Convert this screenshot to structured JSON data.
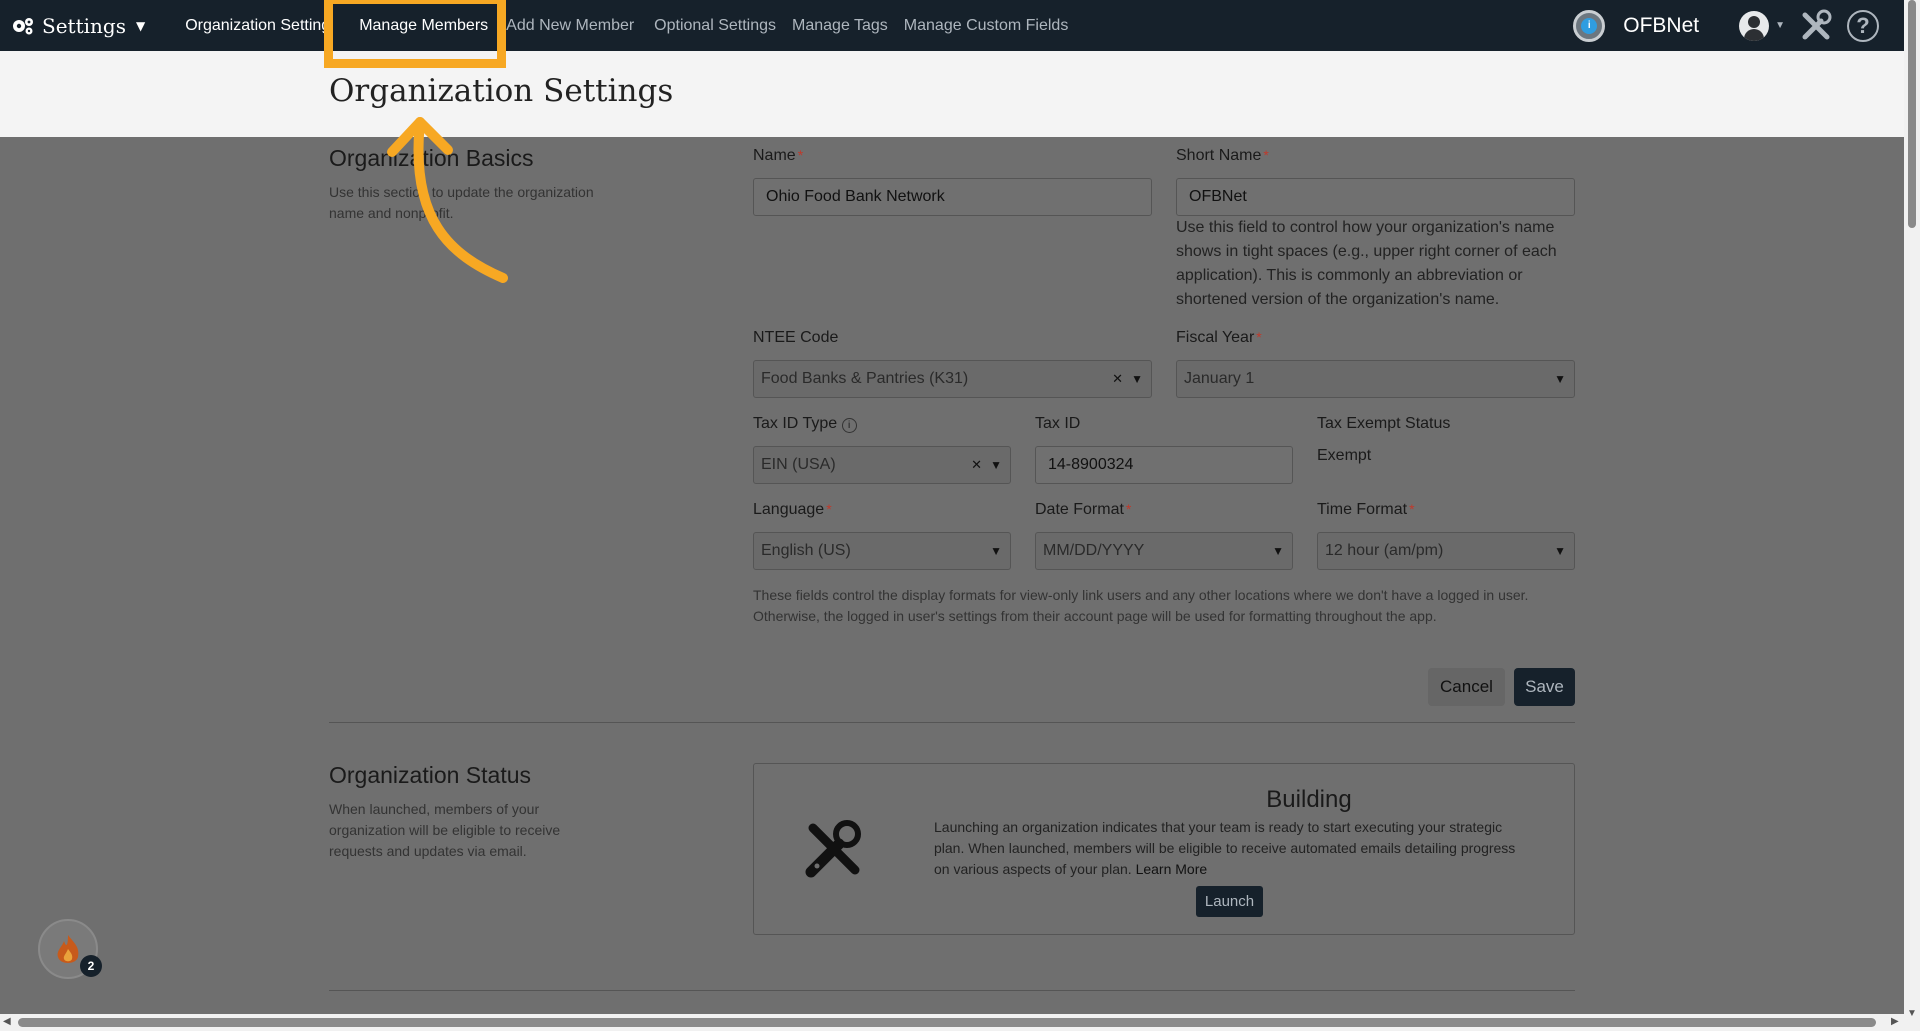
{
  "nav": {
    "brand_label": "Settings",
    "links": {
      "org_settings": "Organization Settings",
      "manage_members": "Manage Members",
      "add_new_member": "Add New Member",
      "optional_settings": "Optional Settings",
      "manage_tags": "Manage Tags",
      "manage_custom_fields": "Manage Custom Fields"
    },
    "org_name": "OFBNet",
    "org_icon_letter": "i"
  },
  "page": {
    "title": "Organization Settings"
  },
  "basics": {
    "title": "Organization Basics",
    "description": "Use this section to update the organization name and nonprofit.",
    "name_label": "Name",
    "name_value": "Ohio Food Bank Network",
    "short_name_label": "Short Name",
    "short_name_value": "OFBNet",
    "short_name_help": "Use this field to control how your organization's name shows in tight spaces (e.g., upper right corner of each application). This is commonly an abbreviation or shortened version of the organization's name.",
    "ntee_label": "NTEE Code",
    "ntee_value": "Food Banks & Pantries (K31)",
    "fiscal_label": "Fiscal Year",
    "fiscal_value": "January 1",
    "tax_id_type_label": "Tax ID Type",
    "tax_id_type_value": "EIN (USA)",
    "tax_id_label": "Tax ID",
    "tax_id_value": "14-8900324",
    "tax_exempt_label": "Tax Exempt Status",
    "tax_exempt_value": "Exempt",
    "language_label": "Language",
    "language_value": "English (US)",
    "date_format_label": "Date Format",
    "date_format_value": "MM/DD/YYYY",
    "time_format_label": "Time Format",
    "time_format_value": "12 hour (am/pm)",
    "format_note": "These fields control the display formats for view-only link users and any other locations where we don't have a logged in user. Otherwise, the logged in user's settings from their account page will be used for formatting throughout the app.",
    "cancel_label": "Cancel",
    "save_label": "Save"
  },
  "status": {
    "title": "Organization Status",
    "description": "When launched, members of your organization will be eligible to receive requests and updates via email.",
    "state_title": "Building",
    "state_desc": "Launching an organization indicates that your team is ready to start executing your strategic plan. When launched, members will be eligible to receive automated emails detailing progress on various aspects of your plan.",
    "learn_more": "Learn More",
    "launch_label": "Launch"
  },
  "widget": {
    "count": "2"
  },
  "colors": {
    "nav_bg": "#16212b",
    "highlight": "#f7a823",
    "required": "#c0392b"
  }
}
